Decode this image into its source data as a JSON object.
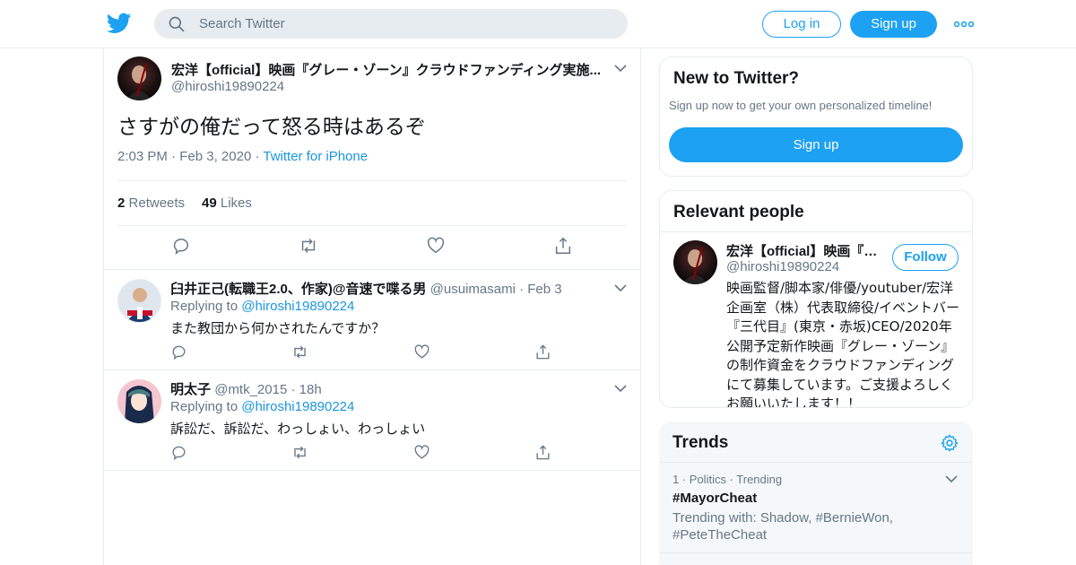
{
  "colors": {
    "accent": "#1da1f2",
    "link": "#1b95e0",
    "muted": "#657786",
    "border": "#e6ecf0"
  },
  "header": {
    "logo_icon": "twitter-bird-icon",
    "search_placeholder": "Search Twitter",
    "login_label": "Log in",
    "signup_label": "Sign up",
    "more_icon": "more-dots-icon"
  },
  "tweet": {
    "author_name": "宏洋【official】映画『グレー・ゾーン』クラウドファンディング実施...",
    "author_handle": "@hiroshi19890224",
    "text": "さすがの俺だって怒る時はあるぞ",
    "time": "2:03 PM",
    "date": "Feb 3, 2020",
    "source": "Twitter for iPhone",
    "retweets_count": "2",
    "retweets_label": "Retweets",
    "likes_count": "49",
    "likes_label": "Likes"
  },
  "replies": [
    {
      "name": "臼井正己(転職王2.0、作家)@音速で喋る男",
      "handle": "@usuimasami",
      "time": "Feb 3",
      "replying_to_label": "Replying to",
      "replying_to": "@hiroshi19890224",
      "text": "また教団から何かされたんですか？"
    },
    {
      "name": "明太子",
      "handle": "@mtk_2015",
      "time": "18h",
      "replying_to_label": "Replying to",
      "replying_to": "@hiroshi19890224",
      "text": "訴訟だ、訴訟だ、わっしょい、わっしょい"
    }
  ],
  "sidebar": {
    "new_to_twitter": {
      "title": "New to Twitter?",
      "subtitle": "Sign up now to get your own personalized timeline!",
      "button": "Sign up"
    },
    "relevant_people": {
      "title": "Relevant people",
      "name": "宏洋【official】映画『グ...",
      "handle": "@hiroshi19890224",
      "follow_label": "Follow",
      "bio": "映画監督/脚本家/俳優/youtuber/宏洋企画室（株）代表取締役/イベントバー『三代目』(東京・赤坂)CEO/2020年公開予定新作映画『グレー・ゾーン』の制作資金をクラウドファンディングにて募集しています。ご支援よろしくお願いいたします！！"
    },
    "trends": {
      "title": "Trends",
      "items": [
        {
          "meta": "1 · Politics · Trending",
          "name": "#MayorCheat",
          "with": "Trending with: Shadow, #BernieWon, #PeteTheCheat"
        }
      ]
    }
  }
}
